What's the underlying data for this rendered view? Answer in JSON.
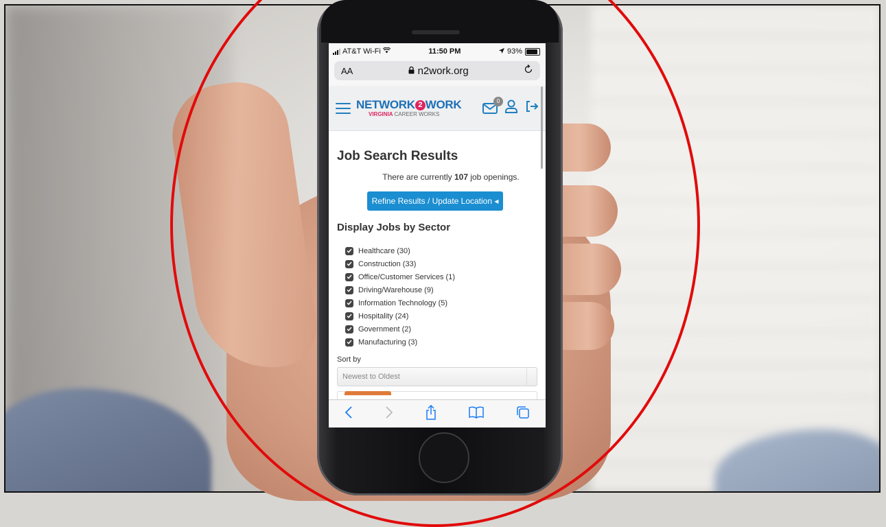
{
  "status_bar": {
    "carrier": "AT&T Wi-Fi",
    "time": "11:50 PM",
    "battery": "93%"
  },
  "browser": {
    "text_size": "AA",
    "url": "n2work.org"
  },
  "site": {
    "logo_main_a": "NETWORK",
    "logo_two": "2",
    "logo_main_b": "WORK",
    "logo_sub_a": "VIRGINIA",
    "logo_sub_b": "CAREER WORKS",
    "mail_badge": "0"
  },
  "page": {
    "title": "Job Search Results",
    "count_prefix": "There are currently ",
    "count": "107",
    "count_suffix": " job openings.",
    "refine_button": "Refine Results / Update Location ◂",
    "sector_heading": "Display Jobs by Sector",
    "sectors": [
      {
        "label": "Healthcare  (30)",
        "checked": true
      },
      {
        "label": "Construction  (33)",
        "checked": true
      },
      {
        "label": "Office/Customer Services  (1)",
        "checked": true
      },
      {
        "label": "Driving/Warehouse  (9)",
        "checked": true
      },
      {
        "label": "Information Technology  (5)",
        "checked": true
      },
      {
        "label": "Hospitality  (24)",
        "checked": true
      },
      {
        "label": "Government  (2)",
        "checked": true
      },
      {
        "label": "Manufacturing  (3)",
        "checked": true
      }
    ],
    "sort_label": "Sort by",
    "sort_value": "Newest to Oldest"
  },
  "colors": {
    "accent_blue": "#1b8ed1",
    "brand_pink": "#e0245e",
    "highlight_circle": "#e10b0b"
  },
  "icons": {
    "menu": "hamburger-icon",
    "mail": "envelope-icon",
    "profile": "user-icon",
    "logout": "sign-out-icon",
    "reload": "reload-icon",
    "lock": "lock-icon",
    "back": "chevron-left-icon",
    "forward": "chevron-right-icon",
    "share": "share-icon",
    "bookmarks": "book-icon",
    "tabs": "tabs-icon"
  }
}
